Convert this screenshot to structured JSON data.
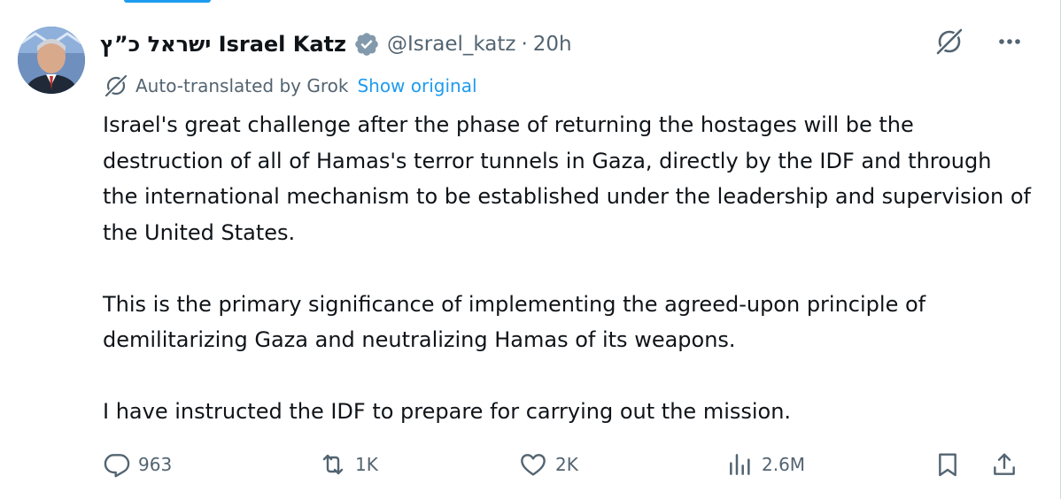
{
  "colors": {
    "text_primary": "#0f1419",
    "text_secondary": "#536471",
    "link": "#1d9bf0",
    "verified_badge": "#829aab"
  },
  "tweet": {
    "author": {
      "display_name": "ישראל כ”ץ Israel Katz",
      "handle": "@Israel_katz",
      "separator": "·",
      "time": "20h",
      "verified_icon": "gray-verified-badge-icon",
      "avatar": "avatar"
    },
    "header_actions": {
      "grok_icon": "grok-icon",
      "more_icon": "more-options-icon"
    },
    "translation": {
      "label": "Auto-translated by Grok",
      "show_original": "Show original",
      "icon": "grok-icon"
    },
    "paragraphs": [
      "Israel's great challenge after the phase of returning the hostages will be the destruction of all of Hamas's terror tunnels in Gaza, directly by the IDF and through the international mechanism to be established under the leadership and supervision of the United States.",
      "This is the primary significance of implementing the agreed-upon principle of demilitarizing Gaza and neutralizing Hamas of its weapons.",
      "I have instructed the IDF to prepare for carrying out the mission."
    ],
    "metrics": {
      "replies": "963",
      "reposts": "1K",
      "likes": "2K",
      "views": "2.6M"
    },
    "action_icons": {
      "reply": "reply-icon",
      "repost": "repost-icon",
      "like": "heart-icon",
      "views": "views-icon",
      "bookmark": "bookmark-icon",
      "share": "share-icon"
    }
  }
}
